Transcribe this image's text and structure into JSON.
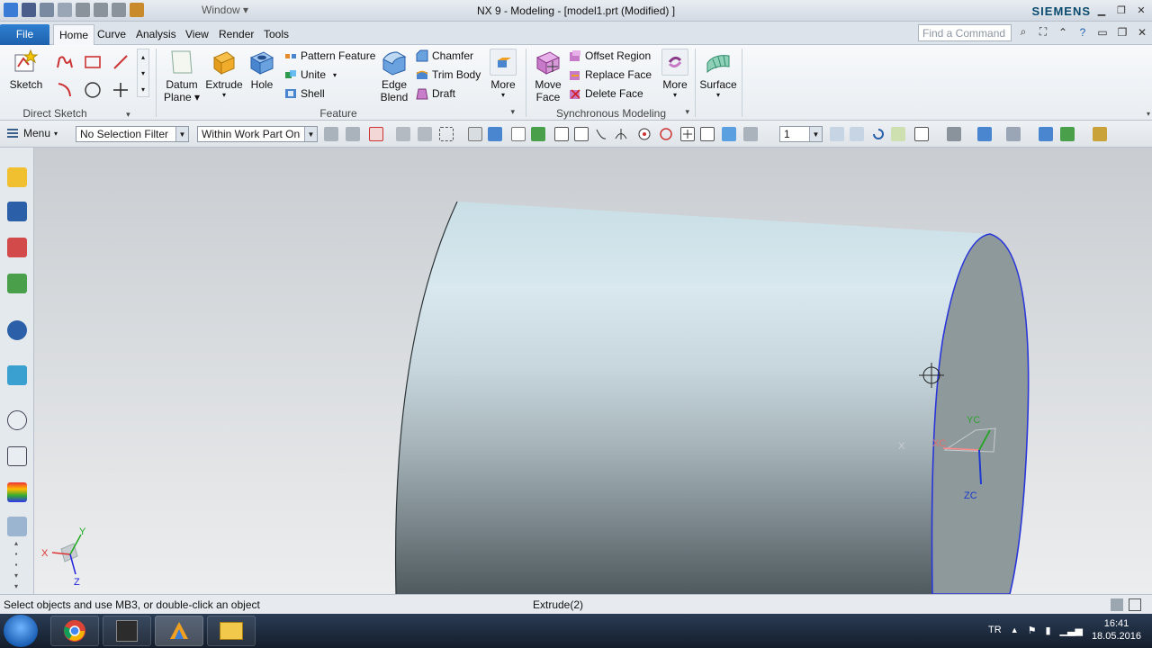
{
  "window": {
    "title": "NX 9 - Modeling - [model1.prt (Modified) ]",
    "window_menu": "Window",
    "brand": "SIEMENS"
  },
  "tabs": [
    "File",
    "Home",
    "Curve",
    "Analysis",
    "View",
    "Render",
    "Tools"
  ],
  "active_tab": "Home",
  "find_command": {
    "placeholder": "Find a Command"
  },
  "ribbon": {
    "direct_sketch": {
      "label": "Direct Sketch",
      "sketch": "Sketch"
    },
    "feature": {
      "label": "Feature",
      "datum_plane_1": "Datum",
      "datum_plane_2": "Plane",
      "extrude": "Extrude",
      "hole": "Hole",
      "pattern_feature": "Pattern Feature",
      "unite": "Unite",
      "shell": "Shell",
      "edge_blend_1": "Edge",
      "edge_blend_2": "Blend",
      "chamfer": "Chamfer",
      "trim_body": "Trim Body",
      "draft": "Draft",
      "more": "More"
    },
    "sync": {
      "label": "Synchronous Modeling",
      "move_face_1": "Move",
      "move_face_2": "Face",
      "offset_region": "Offset Region",
      "replace_face": "Replace Face",
      "delete_face": "Delete Face",
      "more": "More"
    },
    "surface": {
      "label": "Surface"
    }
  },
  "selection_bar": {
    "menu": "Menu",
    "filter": "No Selection Filter",
    "scope": "Within Work Part Only",
    "layer": "1"
  },
  "triad": {
    "xc": "XC",
    "yc": "YC",
    "zc": "ZC",
    "x": "X"
  },
  "view_triad": {
    "x": "X",
    "y": "Y",
    "z": "Z"
  },
  "status": {
    "prompt": "Select objects and use MB3, or double-click an object",
    "feature": "Extrude(2)"
  },
  "taskbar": {
    "lang": "TR",
    "time": "16:41",
    "date": "18.05.2016"
  },
  "colors": {
    "cylinder_top": "#d8e8ee",
    "cylinder_bottom": "#4f5a5f",
    "selected_face": "#8e999c",
    "edge_highlight": "#2a36d8",
    "file_tab": "#1e62ad"
  }
}
